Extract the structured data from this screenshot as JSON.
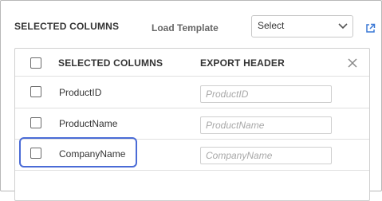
{
  "header": {
    "section_title": "SELECTED COLUMNS",
    "load_template_label": "Load Template",
    "select_value": "Select",
    "external_link_icon": "external-link-icon"
  },
  "table": {
    "headers": {
      "selected_columns": "SELECTED COLUMNS",
      "export_header": "EXPORT HEADER"
    },
    "rows": [
      {
        "name": "ProductID",
        "placeholder": "ProductID",
        "checked": false
      },
      {
        "name": "ProductName",
        "placeholder": "ProductName",
        "checked": false
      },
      {
        "name": "CompanyName",
        "placeholder": "CompanyName",
        "checked": false,
        "highlighted": true
      }
    ]
  },
  "colors": {
    "highlight": "#4a6bd6",
    "link_icon": "#3a78d6"
  }
}
